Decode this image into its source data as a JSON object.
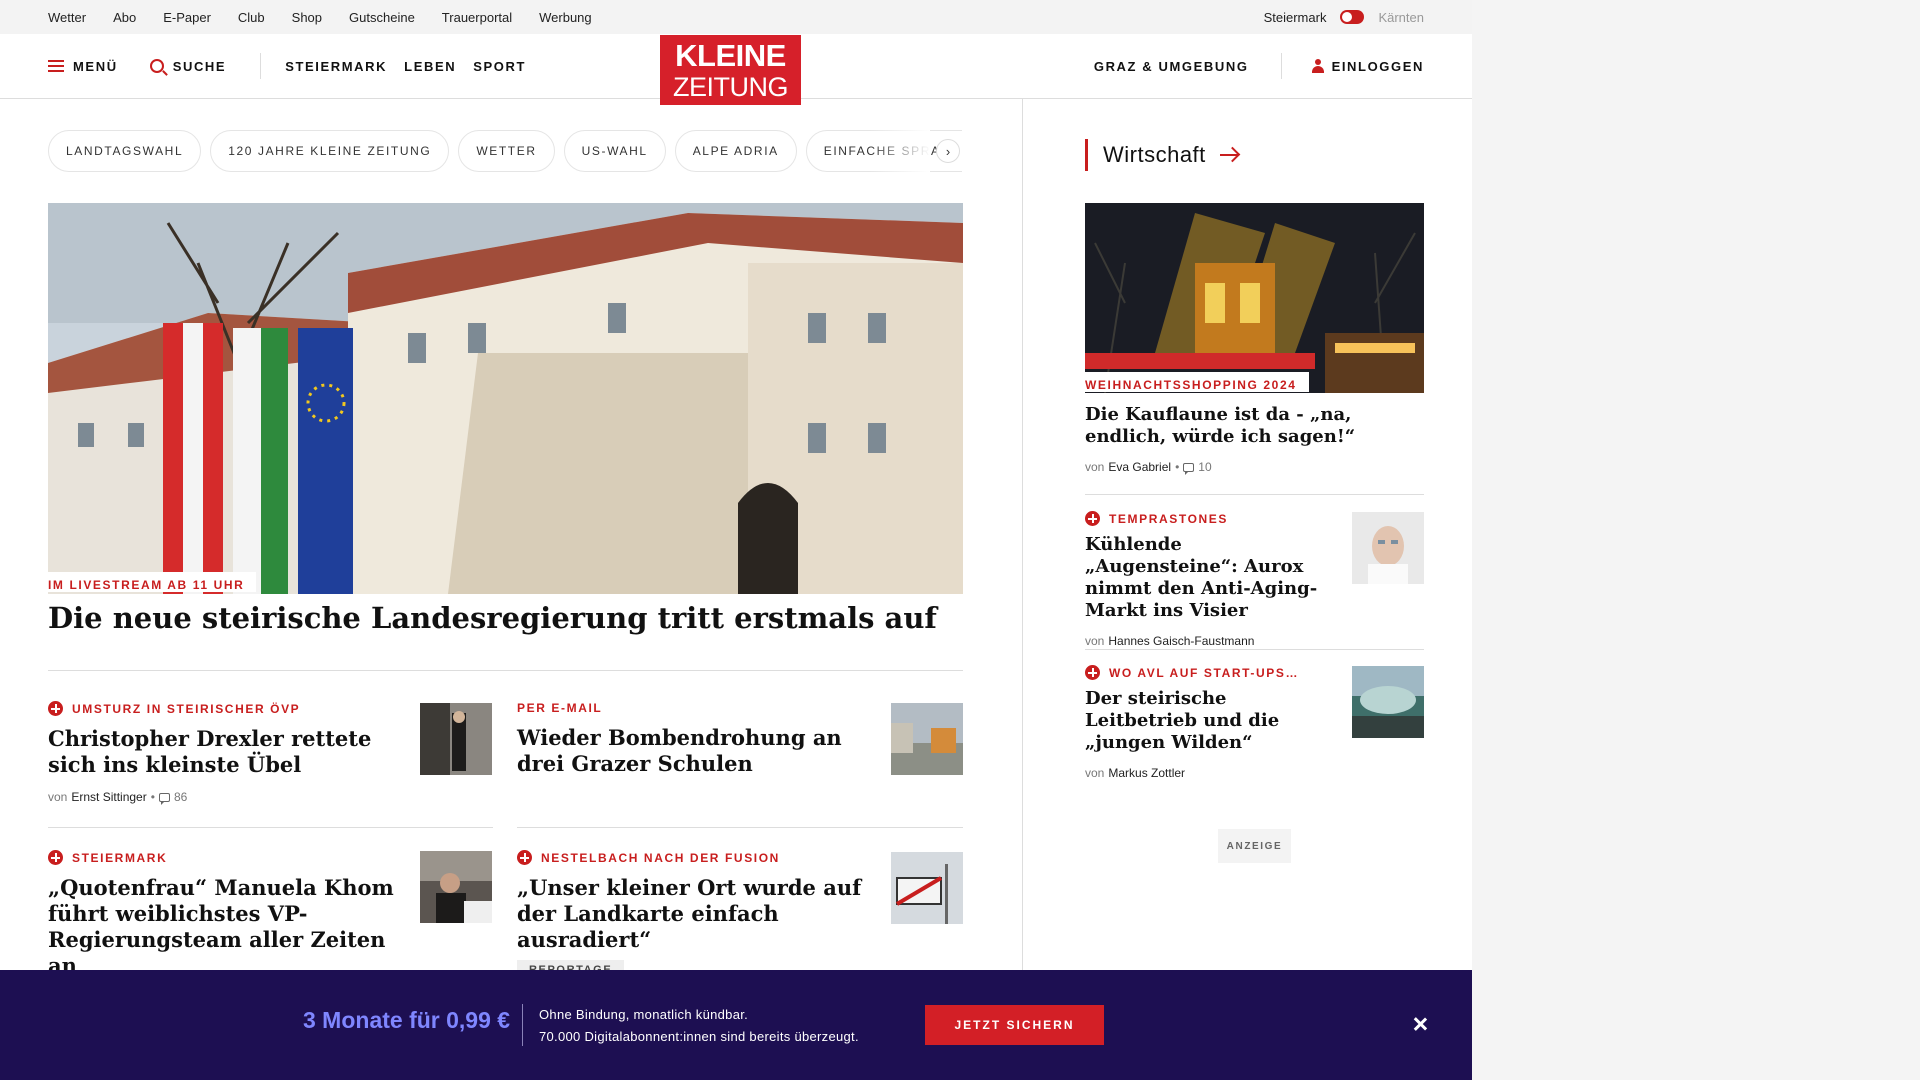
{
  "utility_nav": {
    "links": [
      "Wetter",
      "Abo",
      "E-Paper",
      "Club",
      "Shop",
      "Gutscheine",
      "Trauerportal",
      "Werbung"
    ],
    "region_active": "Steiermark",
    "region_inactive": "Kärnten"
  },
  "header": {
    "menu_label": "MENÜ",
    "search_label": "SUCHE",
    "sections": [
      "STEIERMARK",
      "LEBEN",
      "SPORT"
    ],
    "logo_line1": "KLEINE",
    "logo_line2": "ZEITUNG",
    "region_link": "GRAZ & UMGEBUNG",
    "login_label": "EINLOGGEN"
  },
  "tags": [
    "LANDTAGSWAHL",
    "120 JAHRE KLEINE ZEITUNG",
    "WETTER",
    "US-WAHL",
    "ALPE ADRIA",
    "EINFACHE SPRACHE"
  ],
  "tags_next_label": "›",
  "lead": {
    "kicker": "IM LIVESTREAM AB 11 UHR",
    "title": "Die neue steirische Landesregierung tritt erstmals auf"
  },
  "articles": [
    {
      "kicker": "UMSTURZ IN STEIRISCHER ÖVP",
      "plus": true,
      "title": "Christopher Drexler rettete sich ins kleinste Übel",
      "by": "von",
      "author": "Ernst Sittinger",
      "comments": "86"
    },
    {
      "kicker": "PER E-MAIL",
      "plus": false,
      "title": "Wieder Bombendrohung an drei Grazer Schulen"
    },
    {
      "kicker": "STEIERMARK",
      "plus": true,
      "title": "„Quotenfrau“ Manuela Khom führt weiblichstes VP-Regierungsteam aller Zeiten an"
    },
    {
      "kicker": "NESTELBACH NACH DER FUSION",
      "plus": true,
      "title": "„Unser kleiner Ort wurde auf der Landkarte einfach ausradiert“",
      "badge": "REPORTAGE"
    }
  ],
  "sidebar": {
    "heading": "Wirtschaft",
    "lead": {
      "kicker": "WEIHNACHTSSHOPPING 2024",
      "title": "Die Kauflaune ist da - „na, endlich, würde ich sagen!“",
      "by": "von",
      "author": "Eva Gabriel",
      "comments": "10"
    },
    "items": [
      {
        "kicker": "TEMPRASTONES",
        "title": "Kühlende „Augensteine“: Aurox nimmt den Anti-Aging-Markt ins Visier",
        "by": "von",
        "author": "Hannes Gaisch-Faustmann"
      },
      {
        "kicker": "WO AVL AUF START-UPS…",
        "title": "Der steirische Leitbetrieb und die „jungen Wilden“",
        "by": "von",
        "author": "Markus Zottler"
      }
    ],
    "ad_label": "ANZEIGE"
  },
  "promo": {
    "price": "3 Monate für 0,99 €",
    "line1": "Ohne Bindung, monatlich kündbar.",
    "line2": "70.000 Digitalabonnent:innen sind bereits überzeugt.",
    "cta": "JETZT SICHERN"
  },
  "colors": {
    "brand_red": "#d6202a",
    "accent_red": "#c81e1e",
    "promo_bg": "#1d0f52",
    "promo_price": "#7f86ff"
  }
}
